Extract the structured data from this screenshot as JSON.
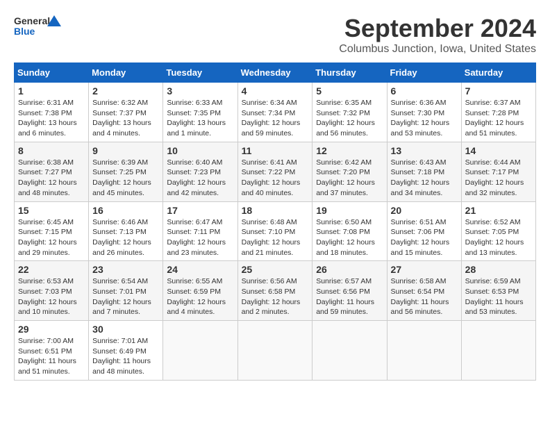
{
  "header": {
    "logo_line1": "General",
    "logo_line2": "Blue",
    "month_title": "September 2024",
    "location": "Columbus Junction, Iowa, United States"
  },
  "weekdays": [
    "Sunday",
    "Monday",
    "Tuesday",
    "Wednesday",
    "Thursday",
    "Friday",
    "Saturday"
  ],
  "weeks": [
    [
      {
        "day": "1",
        "info": "Sunrise: 6:31 AM\nSunset: 7:38 PM\nDaylight: 13 hours and 6 minutes."
      },
      {
        "day": "2",
        "info": "Sunrise: 6:32 AM\nSunset: 7:37 PM\nDaylight: 13 hours and 4 minutes."
      },
      {
        "day": "3",
        "info": "Sunrise: 6:33 AM\nSunset: 7:35 PM\nDaylight: 13 hours and 1 minute."
      },
      {
        "day": "4",
        "info": "Sunrise: 6:34 AM\nSunset: 7:34 PM\nDaylight: 12 hours and 59 minutes."
      },
      {
        "day": "5",
        "info": "Sunrise: 6:35 AM\nSunset: 7:32 PM\nDaylight: 12 hours and 56 minutes."
      },
      {
        "day": "6",
        "info": "Sunrise: 6:36 AM\nSunset: 7:30 PM\nDaylight: 12 hours and 53 minutes."
      },
      {
        "day": "7",
        "info": "Sunrise: 6:37 AM\nSunset: 7:28 PM\nDaylight: 12 hours and 51 minutes."
      }
    ],
    [
      {
        "day": "8",
        "info": "Sunrise: 6:38 AM\nSunset: 7:27 PM\nDaylight: 12 hours and 48 minutes."
      },
      {
        "day": "9",
        "info": "Sunrise: 6:39 AM\nSunset: 7:25 PM\nDaylight: 12 hours and 45 minutes."
      },
      {
        "day": "10",
        "info": "Sunrise: 6:40 AM\nSunset: 7:23 PM\nDaylight: 12 hours and 42 minutes."
      },
      {
        "day": "11",
        "info": "Sunrise: 6:41 AM\nSunset: 7:22 PM\nDaylight: 12 hours and 40 minutes."
      },
      {
        "day": "12",
        "info": "Sunrise: 6:42 AM\nSunset: 7:20 PM\nDaylight: 12 hours and 37 minutes."
      },
      {
        "day": "13",
        "info": "Sunrise: 6:43 AM\nSunset: 7:18 PM\nDaylight: 12 hours and 34 minutes."
      },
      {
        "day": "14",
        "info": "Sunrise: 6:44 AM\nSunset: 7:17 PM\nDaylight: 12 hours and 32 minutes."
      }
    ],
    [
      {
        "day": "15",
        "info": "Sunrise: 6:45 AM\nSunset: 7:15 PM\nDaylight: 12 hours and 29 minutes."
      },
      {
        "day": "16",
        "info": "Sunrise: 6:46 AM\nSunset: 7:13 PM\nDaylight: 12 hours and 26 minutes."
      },
      {
        "day": "17",
        "info": "Sunrise: 6:47 AM\nSunset: 7:11 PM\nDaylight: 12 hours and 23 minutes."
      },
      {
        "day": "18",
        "info": "Sunrise: 6:48 AM\nSunset: 7:10 PM\nDaylight: 12 hours and 21 minutes."
      },
      {
        "day": "19",
        "info": "Sunrise: 6:50 AM\nSunset: 7:08 PM\nDaylight: 12 hours and 18 minutes."
      },
      {
        "day": "20",
        "info": "Sunrise: 6:51 AM\nSunset: 7:06 PM\nDaylight: 12 hours and 15 minutes."
      },
      {
        "day": "21",
        "info": "Sunrise: 6:52 AM\nSunset: 7:05 PM\nDaylight: 12 hours and 13 minutes."
      }
    ],
    [
      {
        "day": "22",
        "info": "Sunrise: 6:53 AM\nSunset: 7:03 PM\nDaylight: 12 hours and 10 minutes."
      },
      {
        "day": "23",
        "info": "Sunrise: 6:54 AM\nSunset: 7:01 PM\nDaylight: 12 hours and 7 minutes."
      },
      {
        "day": "24",
        "info": "Sunrise: 6:55 AM\nSunset: 6:59 PM\nDaylight: 12 hours and 4 minutes."
      },
      {
        "day": "25",
        "info": "Sunrise: 6:56 AM\nSunset: 6:58 PM\nDaylight: 12 hours and 2 minutes."
      },
      {
        "day": "26",
        "info": "Sunrise: 6:57 AM\nSunset: 6:56 PM\nDaylight: 11 hours and 59 minutes."
      },
      {
        "day": "27",
        "info": "Sunrise: 6:58 AM\nSunset: 6:54 PM\nDaylight: 11 hours and 56 minutes."
      },
      {
        "day": "28",
        "info": "Sunrise: 6:59 AM\nSunset: 6:53 PM\nDaylight: 11 hours and 53 minutes."
      }
    ],
    [
      {
        "day": "29",
        "info": "Sunrise: 7:00 AM\nSunset: 6:51 PM\nDaylight: 11 hours and 51 minutes."
      },
      {
        "day": "30",
        "info": "Sunrise: 7:01 AM\nSunset: 6:49 PM\nDaylight: 11 hours and 48 minutes."
      },
      {
        "day": "",
        "info": ""
      },
      {
        "day": "",
        "info": ""
      },
      {
        "day": "",
        "info": ""
      },
      {
        "day": "",
        "info": ""
      },
      {
        "day": "",
        "info": ""
      }
    ]
  ]
}
